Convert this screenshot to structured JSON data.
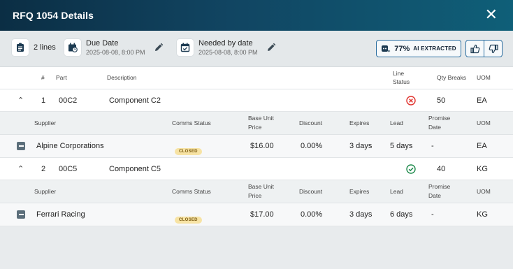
{
  "header": {
    "title": "RFQ 1054 Details",
    "close_label": "✕"
  },
  "toolbar": {
    "lines": "2 lines",
    "due_date": {
      "label": "Due Date",
      "value": "2025-08-08, 8:00 PM"
    },
    "needed_by": {
      "label": "Needed by date",
      "value": "2025-08-08, 8:00 PM"
    },
    "ai": {
      "pct": "77%",
      "label": "AI EXTRACTED"
    }
  },
  "table_headers": {
    "num": "#",
    "part": "Part",
    "description": "Description",
    "line_status_1": "Line",
    "line_status_2": "Status",
    "qty_breaks": "Qty Breaks",
    "uom": "UOM"
  },
  "supplier_headers": {
    "supplier": "Supplier",
    "comms": "Comms Status",
    "base_price_1": "Base  Unit",
    "base_price_2": "Price",
    "discount": "Discount",
    "expires": "Expires",
    "lead": "Lead",
    "promise_1": "Promise",
    "promise_2": "Date",
    "uom": "UOM"
  },
  "lines": [
    {
      "num": "1",
      "part": "00C2",
      "description": "Component C2",
      "status": "error",
      "qty": "50",
      "uom": "EA",
      "supplier": {
        "name": "Alpine Corporations",
        "comms": "CLOSED",
        "price": "$16.00",
        "discount": "0.00%",
        "expires": "3 days",
        "lead": "5 days",
        "promise": "-",
        "uom": "EA"
      }
    },
    {
      "num": "2",
      "part": "00C5",
      "description": "Component C5",
      "status": "ok",
      "qty": "40",
      "uom": "KG",
      "supplier": {
        "name": "Ferrari Racing",
        "comms": "CLOSED",
        "price": "$17.00",
        "discount": "0.00%",
        "expires": "3 days",
        "lead": "6 days",
        "promise": "-",
        "uom": "KG"
      }
    }
  ],
  "colors": {
    "error": "#e0302b",
    "ok": "#1f8a4c",
    "header_dark": "#0b2e44",
    "accent": "#2b6ea0"
  }
}
